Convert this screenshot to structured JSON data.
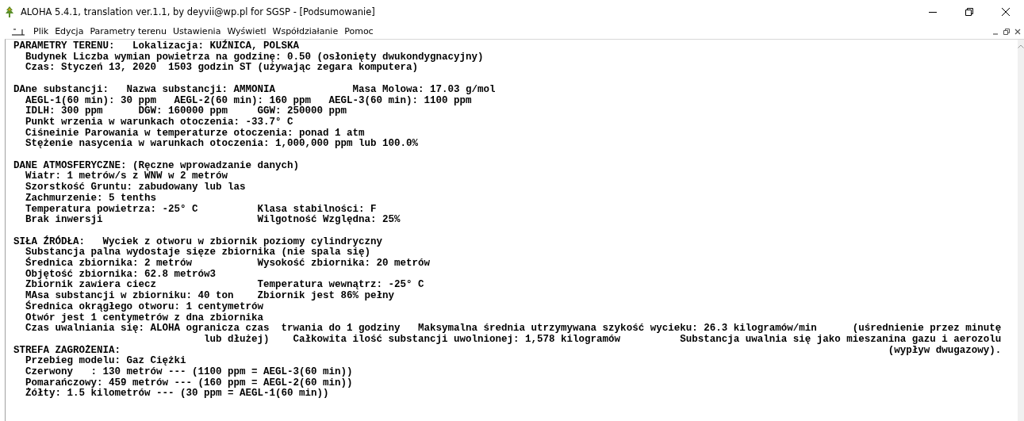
{
  "window": {
    "title": "ALOHA 5.4.1, translation ver.1.1, by deyvii@wp.pl for SGSP - [Podsumowanie]"
  },
  "menu": [
    "Plik",
    "Edycja",
    "Parametry terenu",
    "Ustawienia",
    "Wyświetl",
    "Współdziałanie",
    "Pomoc"
  ],
  "sections": [
    {
      "lines": [
        "PARAMETRY TERENU:   Lokalizacja: KUŹNICA, POLSKA",
        "  Budynek Liczba wymian powietrza na godzinę: 0.50 (osłonięty dwukondygnacyjny)",
        "  Czas: Styczeń 13, 2020  1503 godzin ST (używając zegara komputera)"
      ]
    },
    {
      "lines": [
        "DAne substancji:   Nazwa substancji: AMMONIA             Masa Molowa: 17.03 g/mol",
        "  AEGL-1(60 min): 30 ppm   AEGL-2(60 min): 160 ppm   AEGL-3(60 min): 1100 ppm",
        "  IDLH: 300 ppm      DGW: 160000 ppm     GGW: 250000 ppm",
        "  Punkt wrzenia w warunkach otoczenia: -33.7° C",
        "  Ciśneinie Parowania w temperaturze otoczenia: ponad 1 atm",
        "  Stężenie nasycenia w warunkach otoczenia: 1,000,000 ppm lub 100.0%"
      ]
    },
    {
      "lines": [
        "DANE ATMOSFERYCZNE: (Ręczne wprowadzanie danych)",
        "  Wiatr: 1 metrów/s z WNW w 2 metrów",
        "  Szorstkość Gruntu: zabudowany lub las",
        "  Zachmurzenie: 5 tenths",
        "  Temperatura powietrza: -25° C          Klasa stabilności: F",
        "  Brak inwersji                          Wilgotność Względna: 25%"
      ]
    },
    {
      "lines": [
        "SIŁA ŹRÓDŁA:   Wyciek z otworu w zbiornik poziomy cylindryczny",
        "  Substancja palna wydostaje sięze zbiornika (nie spala się)",
        "  Średnica zbiornika: 2 metrów           Wysokość zbiornika: 20 metrów",
        "  Objętość zbiornika: 62.8 metrów3",
        "  Zbiornik zawiera ciecz                 Temperatura wewnątrz: -25° C",
        "  MAsa substancji w zbiorniku: 40 ton    Zbiornik jest 86% pełny",
        "  Średnica okrągłego otworu: 1 centymetrów",
        "  Otwór jest 1 centymetrów z dna zbiornika",
        "  Czas uwalniania się: ALOHA ogranicza czas  trwania do 1 godziny   Maksymalna średnia utrzymywana szykość wycieku: 26.3 kilogramów/min      (uśrednienie przez minutę",
        "                                lub dłużej)    Całkowita ilość substancji uwolnionej: 1,578 kilogramów          Substancja uwalnia się jako mieszanina gazu i aerozolu",
        "STREFA ZAGROŻENIA:                                                                                                                                 (wypływ dwugazowy).",
        "  Przebieg modelu: Gaz Ciężki",
        "  Czerwony   : 130 metrów --- (1100 ppm = AEGL-3(60 min))",
        "  Pomarańczowy: 459 metrów --- (160 ppm = AEGL-2(60 min))",
        "  Żółty: 1.5 kilometrów --- (30 ppm = AEGL-1(60 min))"
      ]
    }
  ]
}
